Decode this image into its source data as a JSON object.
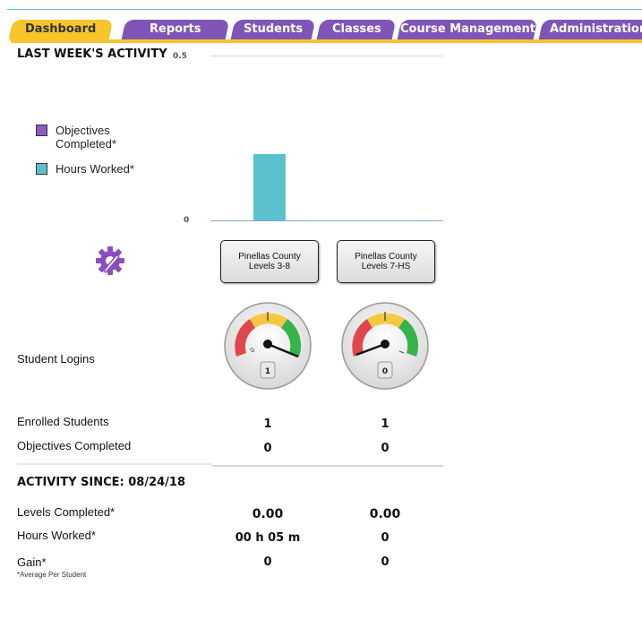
{
  "tabs": [
    {
      "label": "Dashboard",
      "active": true
    },
    {
      "label": "Reports",
      "active": false
    },
    {
      "label": "Students",
      "active": false
    },
    {
      "label": "Classes",
      "active": false
    },
    {
      "label": "Course Management",
      "active": false
    },
    {
      "label": "Administration",
      "active": false
    }
  ],
  "activity": {
    "title": "LAST WEEK'S ACTIVITY",
    "y_top": "0.5",
    "y_bottom": "0",
    "legend": [
      {
        "label": "Objectives Completed*",
        "color": "#8a5cc0"
      },
      {
        "label": "Hours Worked*",
        "color": "#5cc1cf"
      }
    ]
  },
  "chart_data": {
    "type": "bar",
    "categories": [
      "Pinellas County Levels 3-8",
      "Pinellas County Levels 7-HS"
    ],
    "series": [
      {
        "name": "Objectives Completed*",
        "values": [
          0,
          0
        ]
      },
      {
        "name": "Hours Worked*",
        "values": [
          0.2,
          0
        ]
      }
    ],
    "ylim": [
      0,
      0.5
    ],
    "yticks": [
      "0",
      "0.5"
    ]
  },
  "courses": [
    {
      "line1": "Pinellas County",
      "line2": "Levels 3-8"
    },
    {
      "line1": "Pinellas County",
      "line2": "Levels 7-HS"
    }
  ],
  "logins": {
    "label": "Student Logins",
    "values": [
      "1",
      "0"
    ],
    "tick_small": "0"
  },
  "enrolled": {
    "label": "Enrolled Students",
    "values": [
      "1",
      "1"
    ]
  },
  "objectives": {
    "label": "Objectives Completed",
    "values": [
      "0",
      "0"
    ]
  },
  "since": {
    "title": "ACTIVITY SINCE: 08/24/18"
  },
  "levels_completed": {
    "label": "Levels Completed*",
    "values": [
      "0.00",
      "0.00"
    ]
  },
  "hours_worked": {
    "label": "Hours Worked*",
    "values": [
      "00 h 05 m",
      "0"
    ]
  },
  "gain": {
    "label": "Gain*",
    "note": "*Average Per Student",
    "values": [
      "0",
      "0"
    ]
  },
  "icons": {
    "settings": "settings-wrench-gear-icon"
  },
  "colors": {
    "tab": "#7f56b8",
    "tab_active": "#f7c52b",
    "gauge_red": "#e0464d",
    "gauge_yellow": "#f5c842",
    "gauge_green": "#36b34a"
  }
}
